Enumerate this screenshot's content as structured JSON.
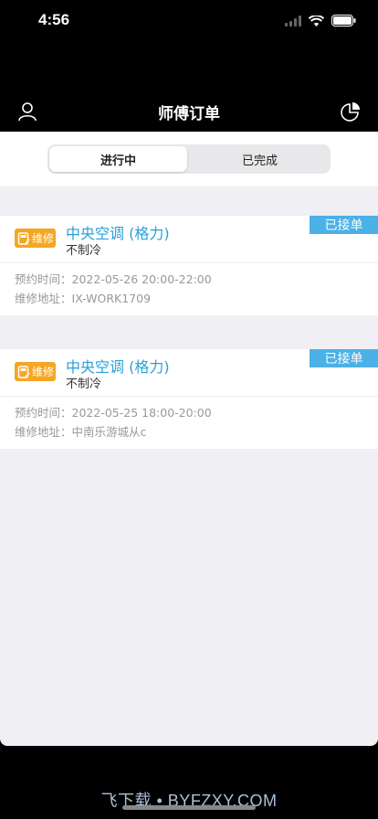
{
  "status_bar": {
    "time": "4:56"
  },
  "nav": {
    "title": "师傅订单"
  },
  "tabs": [
    {
      "label": "进行中",
      "active": true
    },
    {
      "label": "已完成",
      "active": false
    }
  ],
  "orders": [
    {
      "type_badge": "维修",
      "title": "中央空调 (格力)",
      "issue": "不制冷",
      "status": "已接单",
      "time_label": "预约时间：",
      "time_value": "2022-05-26 20:00-22:00",
      "addr_label": "维修地址：",
      "addr_value": "IX-WORK1709"
    },
    {
      "type_badge": "维修",
      "title": "中央空调 (格力)",
      "issue": "不制冷",
      "status": "已接单",
      "time_label": "预约时间：",
      "time_value": "2022-05-25 18:00-20:00",
      "addr_label": "维修地址：",
      "addr_value": "中南乐游城从c"
    }
  ],
  "watermark": "飞下载 • BYFZXY.COM",
  "colors": {
    "accent": "#2a9fd8",
    "status_tag": "#4bb1e6",
    "badge": "#f5a623"
  }
}
